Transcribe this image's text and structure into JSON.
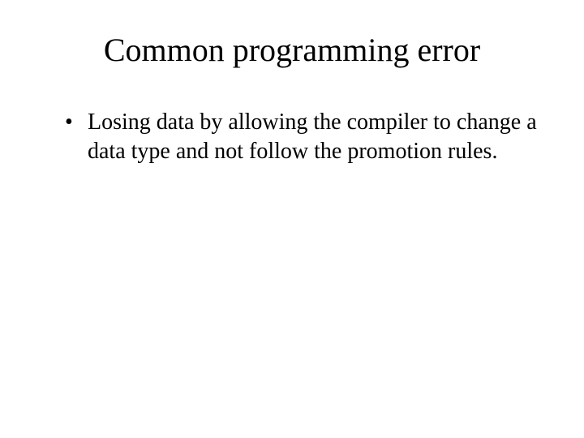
{
  "slide": {
    "title": "Common programming error",
    "bullets": [
      "Losing data by allowing the compiler to change a data type and not follow the promotion rules."
    ]
  }
}
